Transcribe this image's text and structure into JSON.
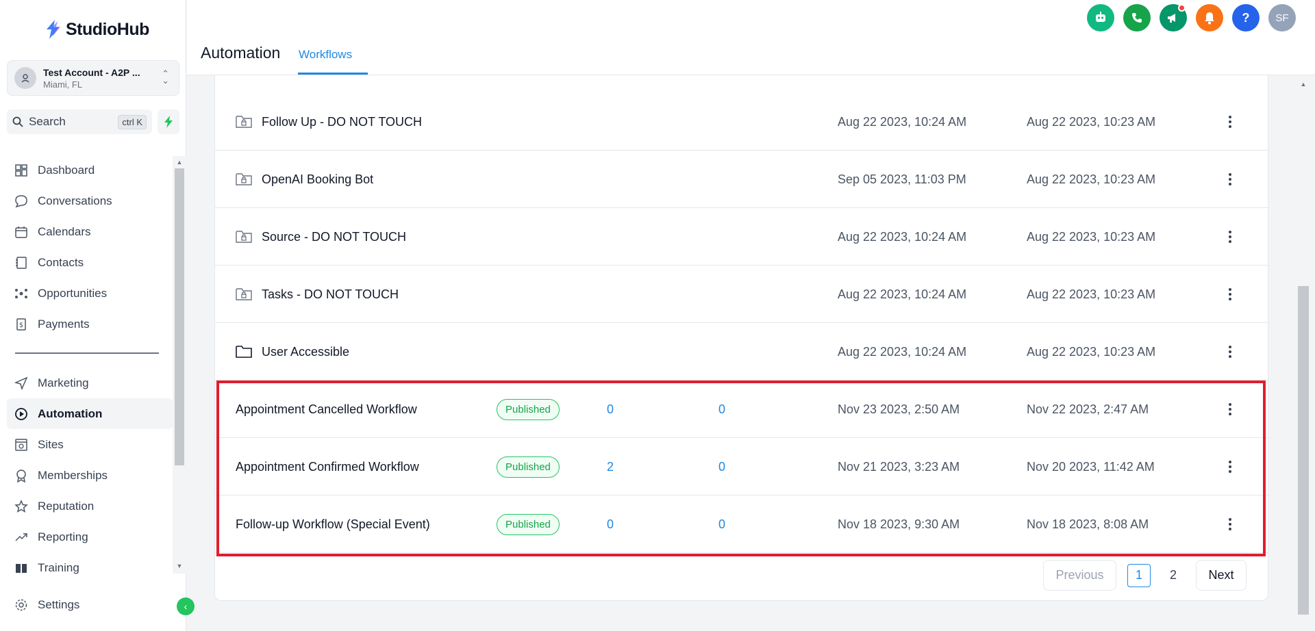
{
  "brand": {
    "name": "StudioHub"
  },
  "account": {
    "name": "Test Account - A2P ...",
    "location": "Miami, FL"
  },
  "search": {
    "label": "Search",
    "shortcut": "ctrl K"
  },
  "nav": {
    "primary": [
      {
        "label": "Dashboard",
        "icon": "dashboard-icon"
      },
      {
        "label": "Conversations",
        "icon": "chat-icon"
      },
      {
        "label": "Calendars",
        "icon": "calendar-icon"
      },
      {
        "label": "Contacts",
        "icon": "contacts-icon"
      },
      {
        "label": "Opportunities",
        "icon": "opportunities-icon"
      },
      {
        "label": "Payments",
        "icon": "payments-icon"
      }
    ],
    "secondary": [
      {
        "label": "Marketing",
        "icon": "send-icon"
      },
      {
        "label": "Automation",
        "icon": "automation-icon",
        "active": true
      },
      {
        "label": "Sites",
        "icon": "sites-icon"
      },
      {
        "label": "Memberships",
        "icon": "memberships-icon"
      },
      {
        "label": "Reputation",
        "icon": "star-icon"
      },
      {
        "label": "Reporting",
        "icon": "trend-icon"
      },
      {
        "label": "Training",
        "icon": "book-icon"
      }
    ],
    "settings": {
      "label": "Settings",
      "icon": "gear-icon"
    }
  },
  "header": {
    "title": "Automation",
    "tab": "Workflows",
    "avatar_initials": "SF",
    "help_label": "?"
  },
  "colors": {
    "accent": "#1e88e5",
    "published": "#16a34a",
    "highlight": "#e11d2e"
  },
  "rows": [
    {
      "name": "Follow Up - DO NOT TOUCH",
      "type": "locked-folder",
      "updated": "Aug 22 2023, 10:24 AM",
      "created": "Aug 22 2023, 10:23 AM"
    },
    {
      "name": "OpenAI Booking Bot",
      "type": "locked-folder",
      "updated": "Sep 05 2023, 11:03 PM",
      "created": "Aug 22 2023, 10:23 AM"
    },
    {
      "name": "Source - DO NOT TOUCH",
      "type": "locked-folder",
      "updated": "Aug 22 2023, 10:24 AM",
      "created": "Aug 22 2023, 10:23 AM"
    },
    {
      "name": "Tasks - DO NOT TOUCH",
      "type": "locked-folder",
      "updated": "Aug 22 2023, 10:24 AM",
      "created": "Aug 22 2023, 10:23 AM"
    },
    {
      "name": "User Accessible",
      "type": "folder",
      "updated": "Aug 22 2023, 10:24 AM",
      "created": "Aug 22 2023, 10:23 AM"
    },
    {
      "name": "Appointment Cancelled Workflow",
      "type": "workflow",
      "status": "Published",
      "total": "0",
      "active": "0",
      "updated": "Nov 23 2023, 2:50 AM",
      "created": "Nov 22 2023, 2:47 AM"
    },
    {
      "name": "Appointment Confirmed Workflow",
      "type": "workflow",
      "status": "Published",
      "total": "2",
      "active": "0",
      "updated": "Nov 21 2023, 3:23 AM",
      "created": "Nov 20 2023, 11:42 AM"
    },
    {
      "name": "Follow-up Workflow (Special Event)",
      "type": "workflow",
      "status": "Published",
      "total": "0",
      "active": "0",
      "updated": "Nov 18 2023, 9:30 AM",
      "created": "Nov 18 2023, 8:08 AM"
    }
  ],
  "pagination": {
    "previous": "Previous",
    "pages": [
      "1",
      "2"
    ],
    "current": "1",
    "next": "Next"
  }
}
